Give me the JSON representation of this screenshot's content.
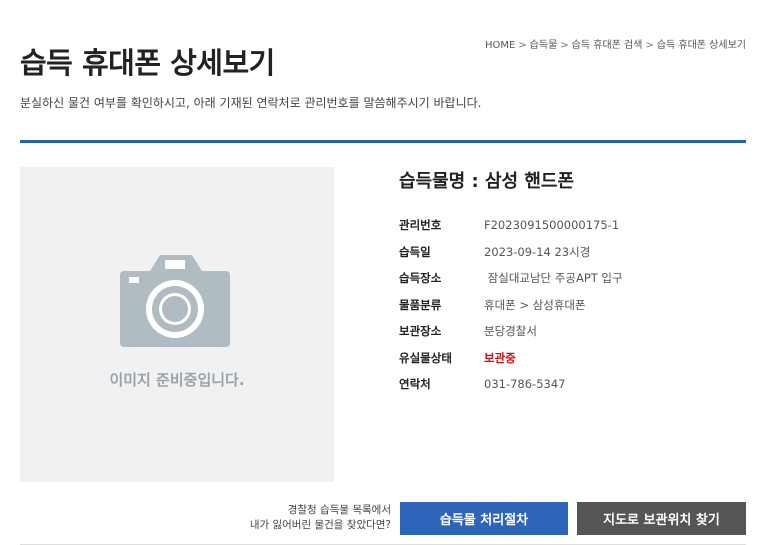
{
  "breadcrumb": {
    "home": "HOME",
    "level1": "습득물",
    "level2": "습득 휴대폰 검색",
    "level3": "습득 휴대폰 상세보기",
    "separator": ">"
  },
  "page": {
    "title": "습득 휴대폰 상세보기",
    "subtitle": "분실하신 물건 여부를 확인하시고, 아래 기재된 연락처로 관리번호를 말씀해주시기 바랍니다."
  },
  "image": {
    "placeholder_text": "이미지 준비중입니다.",
    "icon": "camera-icon",
    "icon_color": "#b1bcc2"
  },
  "item": {
    "title": "습득물명 : 삼성 핸드폰",
    "fields": [
      {
        "label": "관리번호",
        "value": "F2023091500000175-1"
      },
      {
        "label": "습득일",
        "value": "2023-09-14 23시경"
      },
      {
        "label": "습득장소",
        "value": " 잠실대교남단 주공APT 입구"
      },
      {
        "label": "물품분류",
        "value": "휴대폰 > 삼성휴대폰"
      },
      {
        "label": "보관장소",
        "value": "분당경찰서"
      },
      {
        "label": "유실물상태",
        "value": "보관중"
      },
      {
        "label": "연락처",
        "value": "031-786-5347"
      }
    ],
    "status_color": "#cc1111"
  },
  "footer": {
    "help_line1": "경찰청 습득물 목록에서",
    "help_line2": "내가 잃어버린 물건을 찾았다면?",
    "btn_procedure": "습득물 처리절차",
    "btn_map": "지도로 보관위치 찾기"
  },
  "colors": {
    "accent_blue": "#2563ae",
    "button_blue": "#2e65b8",
    "button_gray": "#555555"
  }
}
